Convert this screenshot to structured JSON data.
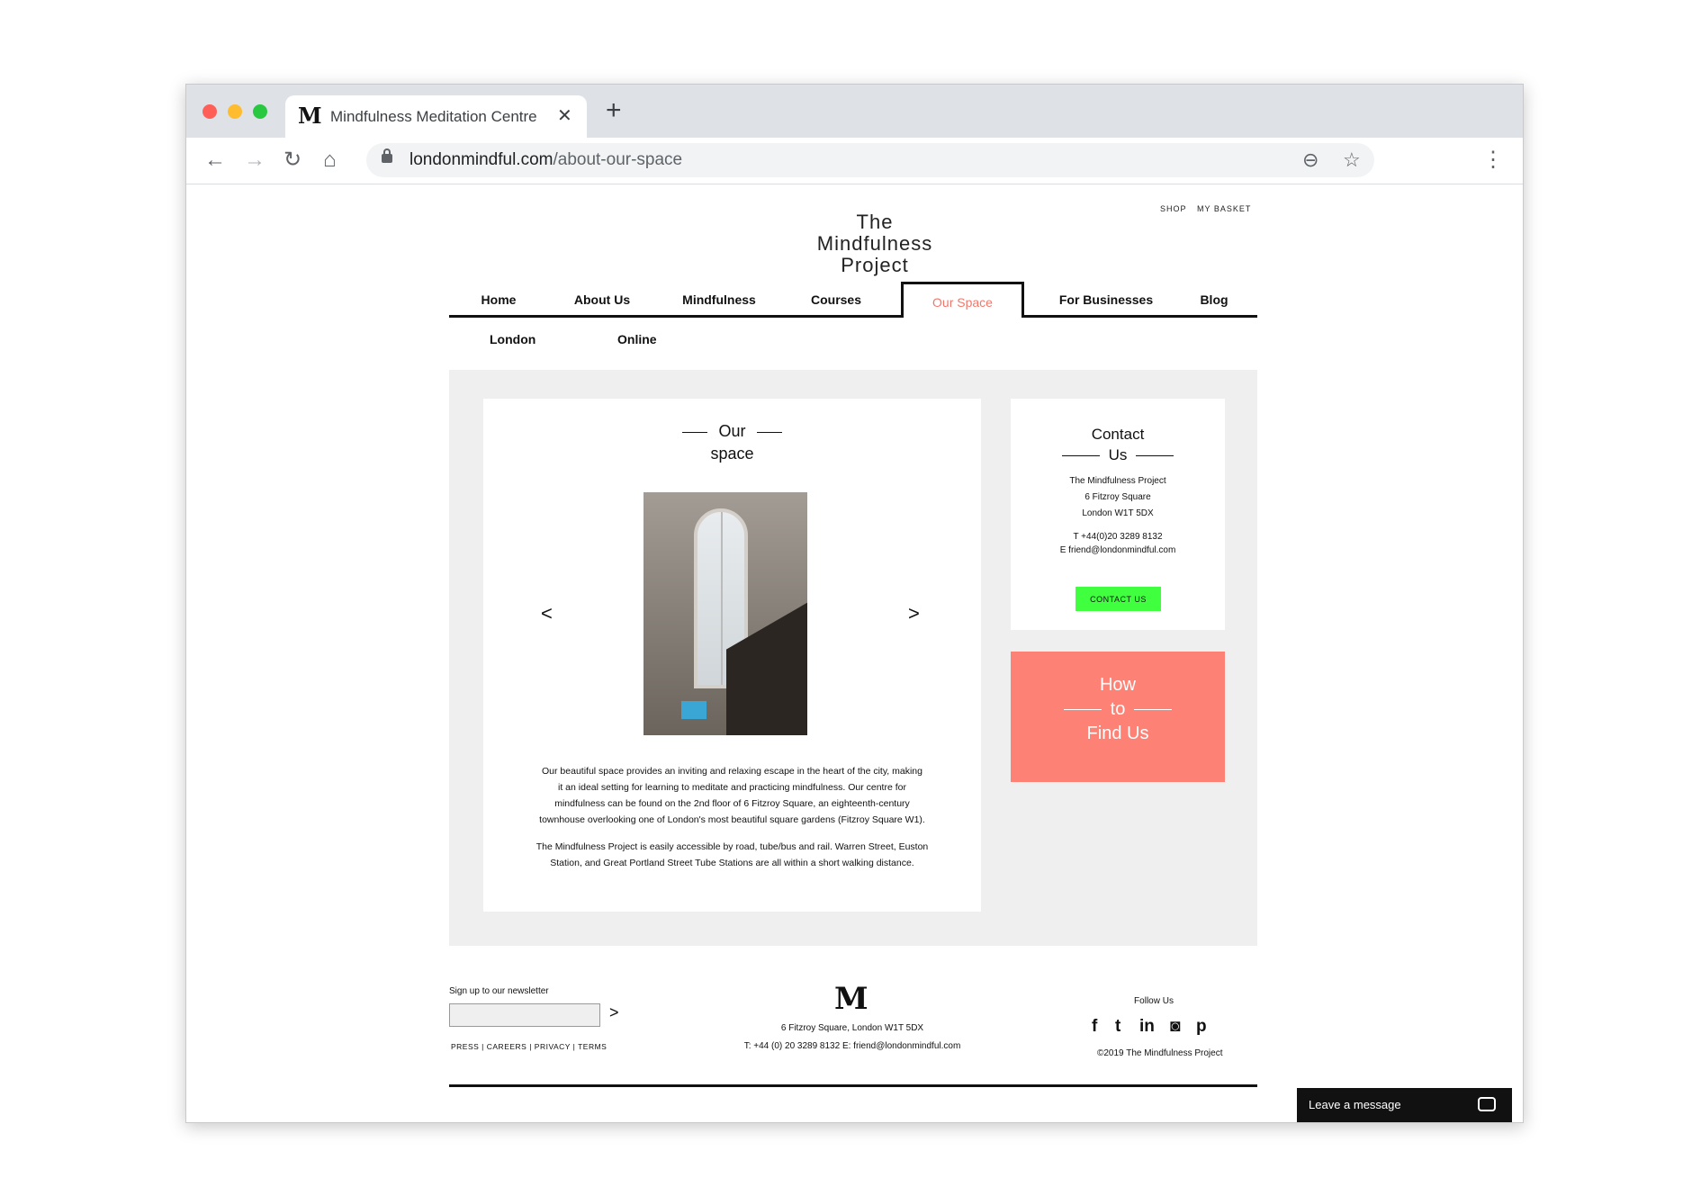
{
  "browser": {
    "tab_favicon": "M",
    "tab_title": "Mindfulness Meditation Centre",
    "tab_close": "✕",
    "new_tab": "+",
    "back": "←",
    "forward": "→",
    "reload": "↻",
    "home": "⌂",
    "url_host": "londonmindful.com",
    "url_path": "/about-our-space",
    "zoom_icon": "⊖",
    "star_icon": "☆",
    "menu_icon": "⋮"
  },
  "header": {
    "brand_line1": "The",
    "brand_line2": "Mindfulness",
    "brand_line3": "Project",
    "shop": "SHOP",
    "basket": "MY BASKET"
  },
  "nav": {
    "items": [
      {
        "label": "Home"
      },
      {
        "label": "About Us"
      },
      {
        "label": "Mindfulness"
      },
      {
        "label": "Courses"
      },
      {
        "label": "Our Space"
      },
      {
        "label": "For Businesses"
      },
      {
        "label": "Blog"
      }
    ],
    "active": "Our Space",
    "sub_items": [
      {
        "label": "London"
      },
      {
        "label": "Online"
      }
    ]
  },
  "main": {
    "heading_line1": "Our",
    "heading_line2": "space",
    "prev": "<",
    "next": ">",
    "para1_l1": "Our beautiful space provides an inviting and relaxing escape in the heart of the city, making",
    "para1_l2": "it an ideal setting for learning to meditate and practicing mindfulness.  Our centre for",
    "para1_l3": "mindfulness can be found on the 2nd floor of 6 Fitzroy Square, an eighteenth-century",
    "para1_l4": "townhouse overlooking one of London's most beautiful square gardens (Fitzroy Square W1).",
    "para2_l1": "The Mindfulness Project is easily accessible by road, tube/bus and rail. Warren Street, Euston",
    "para2_l2": "Station, and Great Portland Street Tube Stations are all within a short walking distance."
  },
  "contact": {
    "heading_line1": "Contact",
    "heading_line2": "Us",
    "addr1": "The Mindfulness Project",
    "addr2": "6 Fitzroy Square",
    "addr3": "London W1T 5DX",
    "phone": "T +44(0)20 3289 8132",
    "email": "E friend@londonmindful.com",
    "button": "CONTACT US"
  },
  "find": {
    "line1": "How",
    "line2": "to",
    "line3": "Find Us"
  },
  "footer": {
    "newsletter_label": "Sign up to our newsletter",
    "newsletter_go": ">",
    "links": "PRESS | CAREERS | PRIVACY | TERMS",
    "logo": "M",
    "address": "6 Fitzroy Square, London W1T 5DX",
    "contact_line": "T: +44 (0) 20 3289 8132 E: friend@londonmindful.com",
    "follow": "Follow Us",
    "social": {
      "facebook": "f",
      "twitter": "t",
      "linkedin": "in",
      "instagram": "◙",
      "pinterest": "p"
    },
    "copyright": "©2019 The Mindfulness Project"
  },
  "chat": {
    "label": "Leave a message"
  },
  "colors": {
    "accent_coral": "#fd8174",
    "contact_green": "#3fff3f",
    "active_nav": "#f2776b"
  }
}
